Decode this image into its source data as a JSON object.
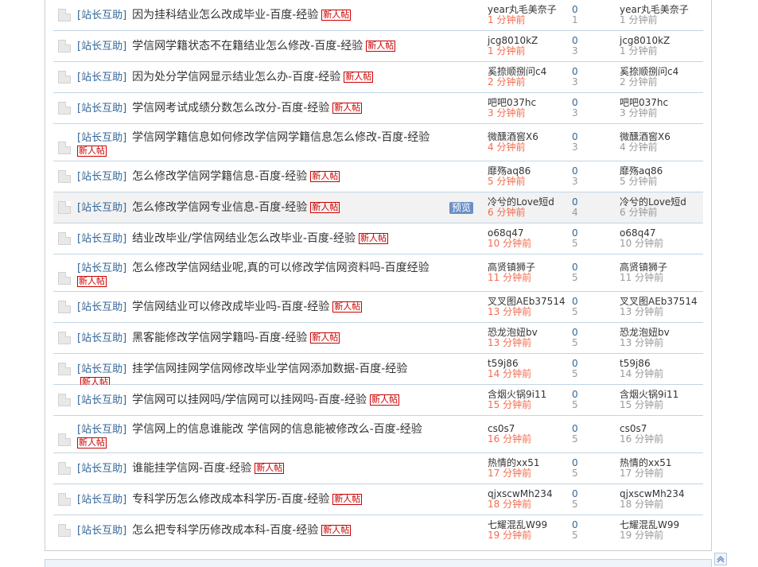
{
  "threads": [
    {
      "category": "[站长互助]",
      "title": "因为挂科结业怎么改成毕业-百度-经验",
      "badge": "新人帖",
      "author": "year丸毛美奈子",
      "author_time": "1 分钟前",
      "replies": "0",
      "views": "1",
      "last_author": "year丸毛美奈子",
      "last_time": "1 分钟前"
    },
    {
      "category": "[站长互助]",
      "title": "学信网学籍状态不在籍结业怎么修改-百度-经验",
      "badge": "新人帖",
      "author": "jcg8010kZ",
      "author_time": "1 分钟前",
      "replies": "0",
      "views": "3",
      "last_author": "jcg8010kZ",
      "last_time": "1 分钟前"
    },
    {
      "category": "[站长互助]",
      "title": "因为处分学信网显示结业怎么办-百度-经验",
      "badge": "新人帖",
      "author": "奚捺顺捌问c4",
      "author_time": "2 分钟前",
      "replies": "0",
      "views": "3",
      "last_author": "奚捺顺捌问c4",
      "last_time": "2 分钟前"
    },
    {
      "category": "[站长互助]",
      "title": "学信网考试成绩分数怎么改分-百度-经验",
      "badge": "新人帖",
      "author": "吧吧037hc",
      "author_time": "3 分钟前",
      "replies": "0",
      "views": "3",
      "last_author": "吧吧037hc",
      "last_time": "3 分钟前"
    },
    {
      "category": "[站长互助]",
      "title": "学信网学籍信息如何修改学信网学籍信息怎么修改-百度-经验",
      "badge": "新人帖",
      "author": "微醺酒窖X6",
      "author_time": "4 分钟前",
      "replies": "0",
      "views": "3",
      "last_author": "微醺酒窖X6",
      "last_time": "4 分钟前",
      "tall": true
    },
    {
      "category": "[站长互助]",
      "title": "怎么修改学信网学籍信息-百度-经验",
      "badge": "新人帖",
      "author": "靡殇aq86",
      "author_time": "5 分钟前",
      "replies": "0",
      "views": "3",
      "last_author": "靡殇aq86",
      "last_time": "5 分钟前"
    },
    {
      "category": "[站长互助]",
      "title": "怎么修改学信网专业信息-百度-经验",
      "badge": "新人帖",
      "author": "冷兮的Love短d",
      "author_time": "6 分钟前",
      "replies": "0",
      "views": "4",
      "last_author": "冷兮的Love短d",
      "last_time": "6 分钟前",
      "hover": true,
      "preview": "预览"
    },
    {
      "category": "[站长互助]",
      "title": "结业改毕业/学信网结业怎么改毕业-百度-经验",
      "badge": "新人帖",
      "author": "o68q47",
      "author_time": "10 分钟前",
      "replies": "0",
      "views": "5",
      "last_author": "o68q47",
      "last_time": "10 分钟前"
    },
    {
      "category": "[站长互助]",
      "title": "怎么修改学信网结业呢,真的可以修改学信网资料吗-百度经验",
      "badge": "新人帖",
      "author": "高贤镇狮子",
      "author_time": "11 分钟前",
      "replies": "0",
      "views": "5",
      "last_author": "高贤镇狮子",
      "last_time": "11 分钟前",
      "tall": true
    },
    {
      "category": "[站长互助]",
      "title": "学信网结业可以修改成毕业吗-百度-经验",
      "badge": "新人帖",
      "author": "叉叉图AEb37514",
      "author_time": "13 分钟前",
      "replies": "0",
      "views": "5",
      "last_author": "叉叉图AEb37514",
      "last_time": "13 分钟前"
    },
    {
      "category": "[站长互助]",
      "title": "黑客能修改学信网学籍吗-百度-经验",
      "badge": "新人帖",
      "author": "恐龙泡妞bv",
      "author_time": "13 分钟前",
      "replies": "0",
      "views": "5",
      "last_author": "恐龙泡妞bv",
      "last_time": "13 分钟前"
    },
    {
      "category": "[站长互助]",
      "title": "挂学信网挂网学信网修改毕业学信网添加数据-百度-经验",
      "badge": "新人帖",
      "author": "t59j86",
      "author_time": "14 分钟前",
      "replies": "0",
      "views": "5",
      "last_author": "t59j86",
      "last_time": "14 分钟前"
    },
    {
      "category": "[站长互助]",
      "title": "学信网可以挂网吗/学信网可以挂网吗-百度-经验",
      "badge": "新人帖",
      "author": "含烟火锅9i11",
      "author_time": "15 分钟前",
      "replies": "0",
      "views": "5",
      "last_author": "含烟火锅9i11",
      "last_time": "15 分钟前"
    },
    {
      "category": "[站长互助]",
      "title": "学信网上的信息谁能改 学信网的信息能被修改么-百度-经验",
      "badge": "新人帖",
      "author": "cs0s7",
      "author_time": "16 分钟前",
      "replies": "0",
      "views": "5",
      "last_author": "cs0s7",
      "last_time": "16 分钟前",
      "tall": true
    },
    {
      "category": "[站长互助]",
      "title": "谁能挂学信网-百度-经验",
      "badge": "新人帖",
      "author": "热情的xx51",
      "author_time": "17 分钟前",
      "replies": "0",
      "views": "5",
      "last_author": "热情的xx51",
      "last_time": "17 分钟前"
    },
    {
      "category": "[站长互助]",
      "title": "专科学历怎么修改成本科学历-百度-经验",
      "badge": "新人帖",
      "author": "qjxscwMh234",
      "author_time": "18 分钟前",
      "replies": "0",
      "views": "5",
      "last_author": "qjxscwMh234",
      "last_time": "18 分钟前"
    },
    {
      "category": "[站长互助]",
      "title": "怎么把专科学历修改成本科-百度-经验",
      "badge": "新人帖",
      "author": "七耀混乱W99",
      "author_time": "19 分钟前",
      "replies": "0",
      "views": "5",
      "last_author": "七耀混乱W99",
      "last_time": "19 分钟前"
    }
  ],
  "colors": {
    "category": "#336699",
    "badge": "#cc0000",
    "time_recent": "#f26c4f",
    "border": "#c2d5e3"
  }
}
